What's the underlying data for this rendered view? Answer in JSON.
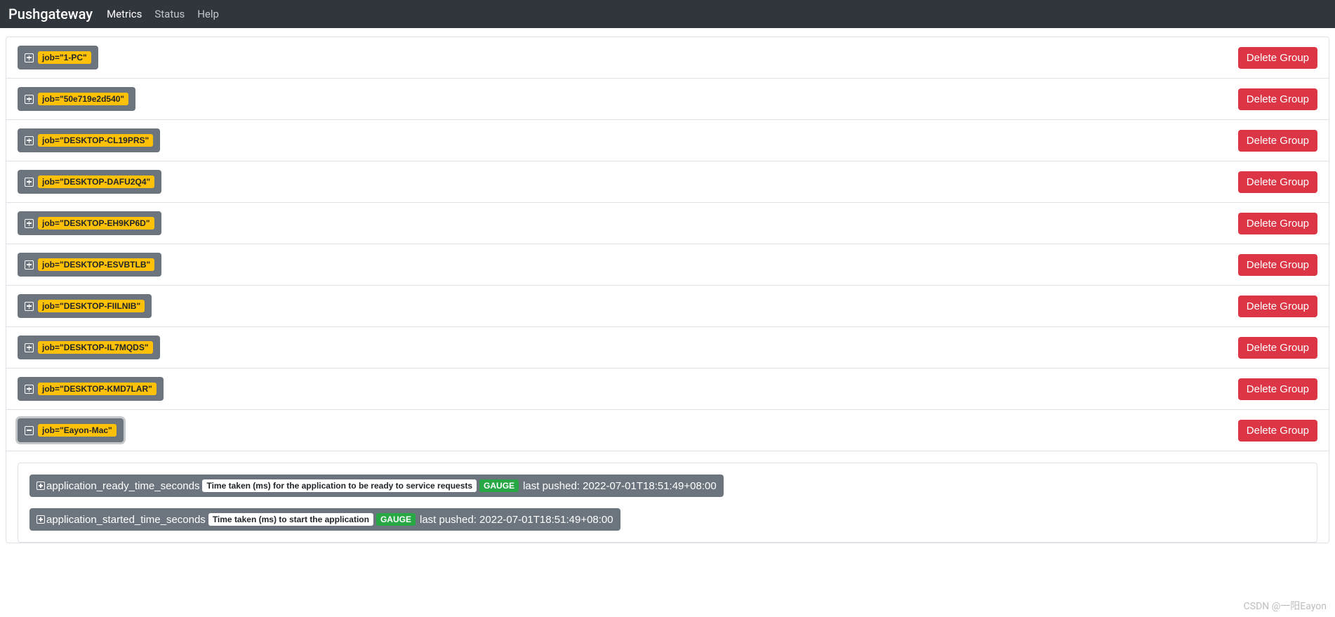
{
  "nav": {
    "brand": "Pushgateway",
    "links": [
      {
        "label": "Metrics",
        "active": true
      },
      {
        "label": "Status",
        "active": false
      },
      {
        "label": "Help",
        "active": false
      }
    ]
  },
  "delete_label": "Delete Group",
  "groups": [
    {
      "job_label": "job=\"1-PC\"",
      "selected": false
    },
    {
      "job_label": "job=\"50e719e2d540\"",
      "selected": false
    },
    {
      "job_label": "job=\"DESKTOP-CL19PRS\"",
      "selected": false
    },
    {
      "job_label": "job=\"DESKTOP-DAFU2Q4\"",
      "selected": false
    },
    {
      "job_label": "job=\"DESKTOP-EH9KP6D\"",
      "selected": false
    },
    {
      "job_label": "job=\"DESKTOP-ESVBTLB\"",
      "selected": false
    },
    {
      "job_label": "job=\"DESKTOP-FIILNIB\"",
      "selected": false
    },
    {
      "job_label": "job=\"DESKTOP-IL7MQDS\"",
      "selected": false
    },
    {
      "job_label": "job=\"DESKTOP-KMD7LAR\"",
      "selected": false
    },
    {
      "job_label": "job=\"Eayon-Mac\"",
      "selected": true
    }
  ],
  "metrics": [
    {
      "name": "application_ready_time_seconds",
      "help": "Time taken (ms) for the application to be ready to service requests",
      "type": "GAUGE",
      "last_pushed": "last pushed: 2022-07-01T18:51:49+08:00"
    },
    {
      "name": "application_started_time_seconds",
      "help": "Time taken (ms) to start the application",
      "type": "GAUGE",
      "last_pushed": "last pushed: 2022-07-01T18:51:49+08:00"
    }
  ],
  "watermark": "CSDN @一阳Eayon"
}
